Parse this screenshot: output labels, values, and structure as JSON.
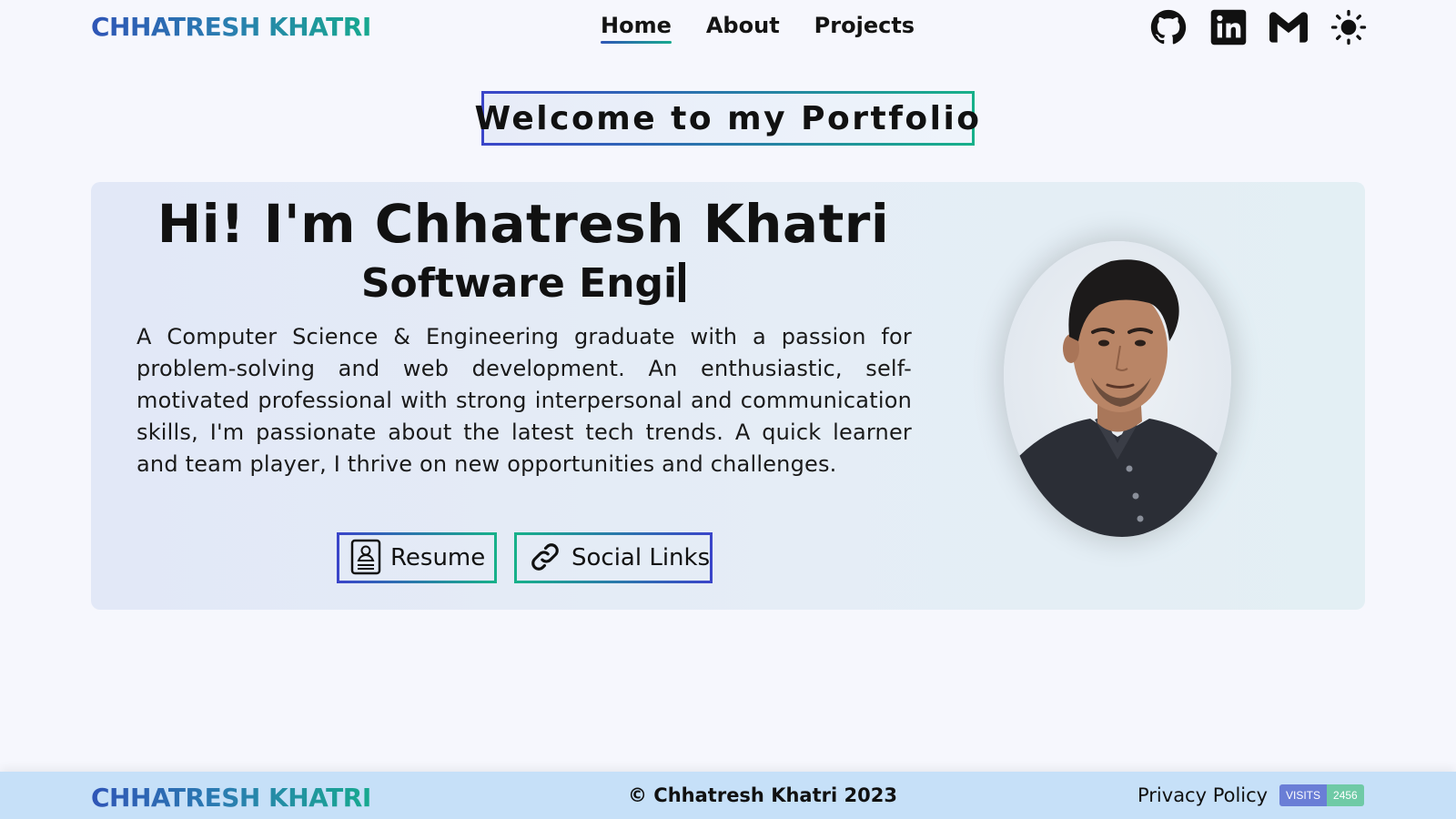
{
  "brand": "CHHATRESH KHATRI",
  "nav": {
    "home": "Home",
    "about": "About",
    "projects": "Projects",
    "active": "home"
  },
  "header_icons": [
    "github-icon",
    "linkedin-icon",
    "gmail-icon",
    "theme-toggle-sun-icon"
  ],
  "welcome": "Welcome to my Portfolio",
  "hero": {
    "title": "Hi! I'm Chhatresh Khatri",
    "typed_subtitle": "Software Engi",
    "description": "A Computer Science & Engineering graduate with a passion for problem-solving and web development. An enthusiastic, self-motivated professional with strong interpersonal and communication skills, I'm passionate about the latest tech trends. A quick learner and team player, I thrive on new opportunities and challenges.",
    "resume_label": "Resume",
    "social_label": "Social Links"
  },
  "footer": {
    "brand": "CHHATRESH KHATRI",
    "copyright": "© Chhatresh Khatri 2023",
    "privacy": "Privacy Policy",
    "visits_label": "VISITS",
    "visits_count": "2456"
  },
  "colors": {
    "gradient_start": "#2f55b6",
    "gradient_end": "#17a98f",
    "footer_bg": "#c6e0f8",
    "page_bg": "#f6f7fd"
  }
}
